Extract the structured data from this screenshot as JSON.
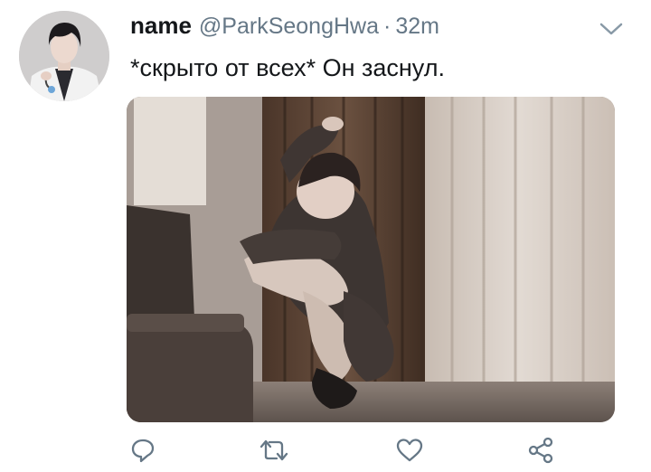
{
  "tweet": {
    "display_name": "name",
    "handle": "@ParkSeongHwa",
    "separator": "·",
    "time": "32m",
    "text": "*скрыто от всех* Он заснул."
  },
  "avatar": {
    "icon": "avatar-photo",
    "colors": {
      "hair": "#1c1a1d",
      "skin": "#e9d6cc",
      "coat": "#f2f2f2"
    }
  },
  "media": {
    "icon": "photo-person-sitting-by-curtains",
    "colors": {
      "curtain_dark": "#5b4536",
      "curtain_light": "#d9cfc6",
      "wall": "#a79c95",
      "chair": "#3b3330"
    }
  },
  "actions": [
    {
      "name": "reply",
      "icon": "speech-bubble-icon"
    },
    {
      "name": "retweet",
      "icon": "retweet-arrows-icon"
    },
    {
      "name": "like",
      "icon": "heart-icon"
    },
    {
      "name": "share",
      "icon": "share-nodes-icon"
    }
  ],
  "colors": {
    "text_primary": "#14171a",
    "text_secondary": "#657786",
    "icon_gray": "#657786"
  }
}
